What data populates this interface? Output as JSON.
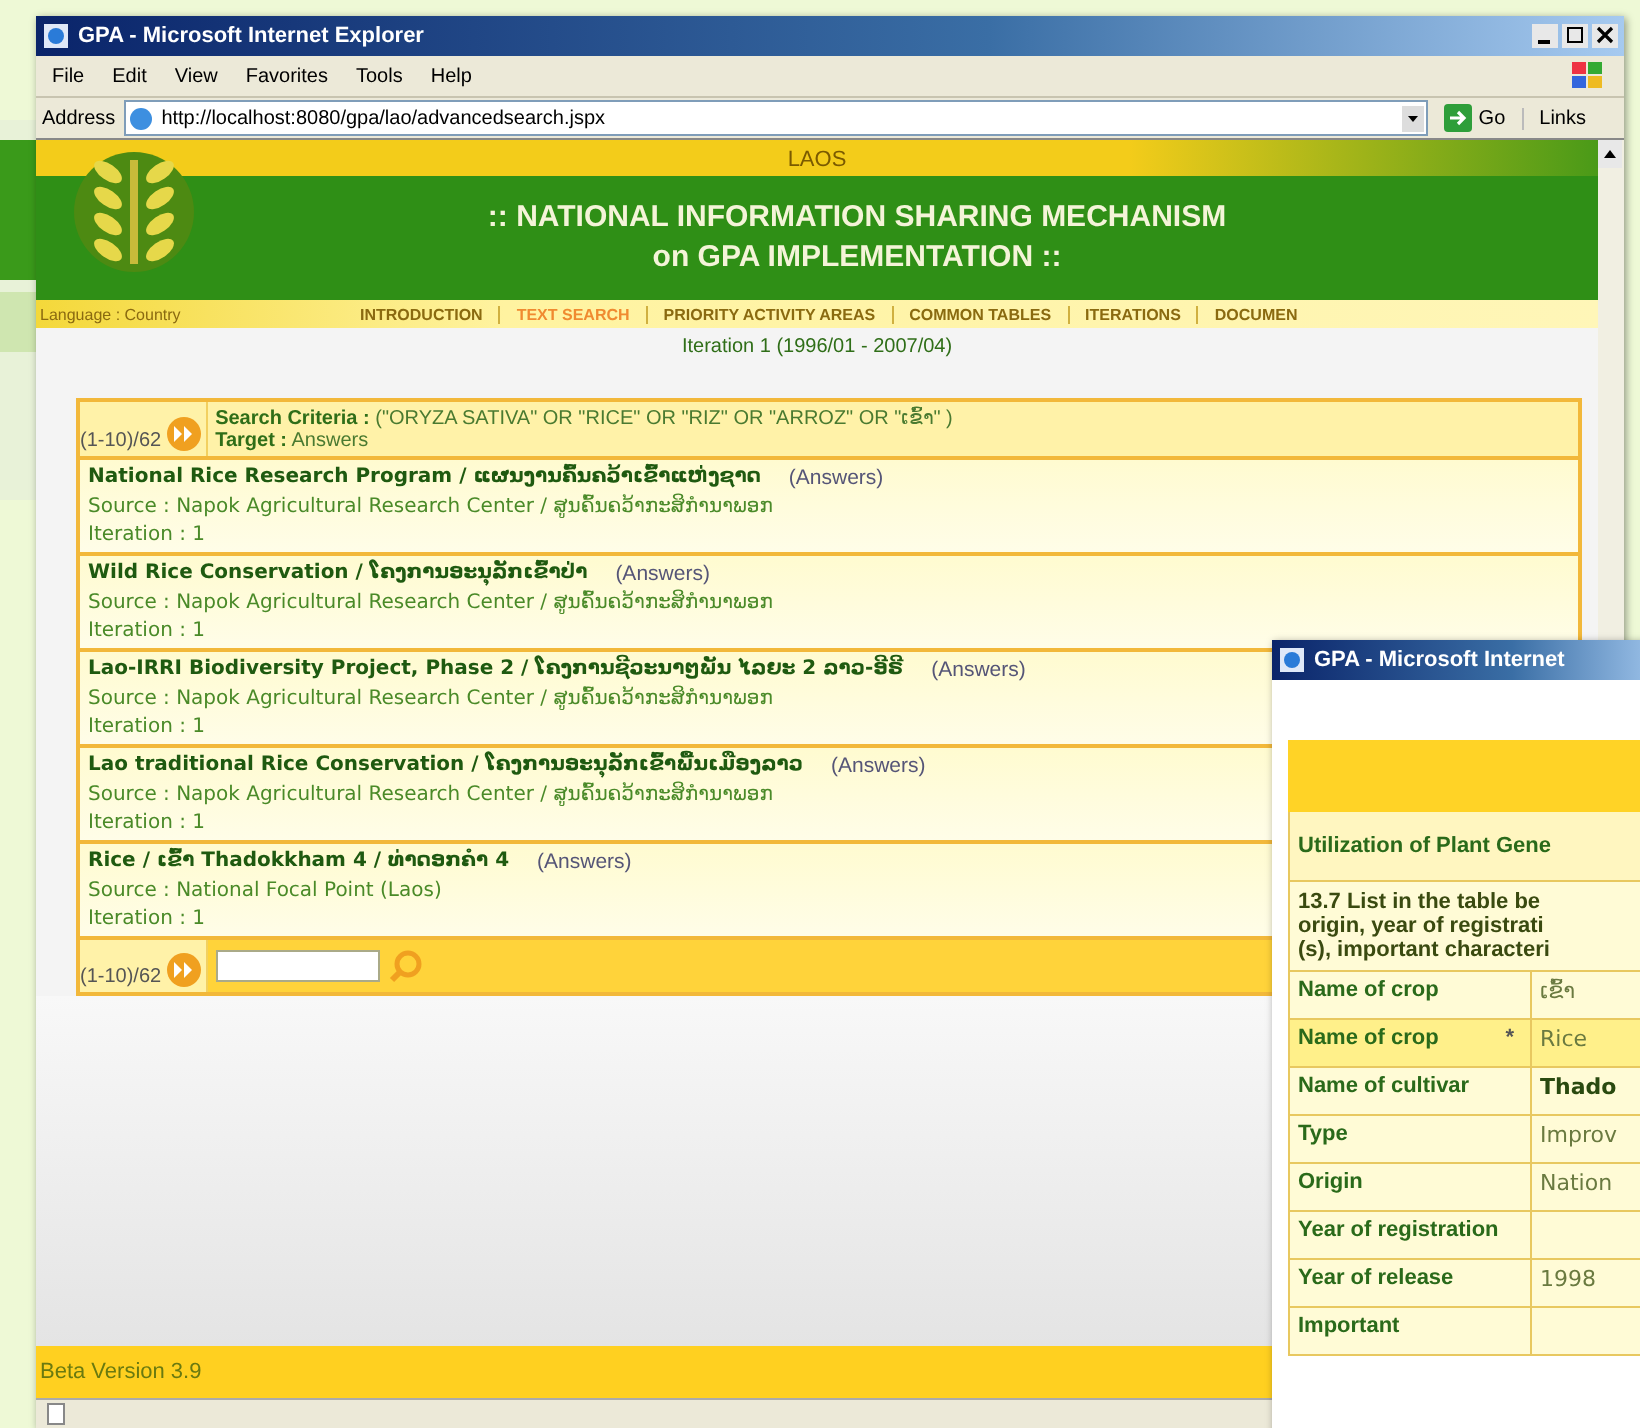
{
  "window": {
    "title": "GPA - Microsoft Internet Explorer"
  },
  "menu": [
    "File",
    "Edit",
    "View",
    "Favorites",
    "Tools",
    "Help"
  ],
  "address_bar": {
    "label": "Address",
    "value": "http://localhost:8080/gpa/lao/advancedsearch.jspx",
    "go": "Go",
    "links": "Links"
  },
  "banner": {
    "country": "LAOS",
    "title_line_1": ":: NATIONAL INFORMATION SHARING MECHANISM",
    "title_line_2": "on GPA IMPLEMENTATION ::"
  },
  "language_link": "Language : Country",
  "nav": [
    {
      "label": "INTRODUCTION",
      "selected": false
    },
    {
      "label": "TEXT SEARCH",
      "selected": true
    },
    {
      "label": "PRIORITY ACTIVITY AREAS",
      "selected": false
    },
    {
      "label": "COMMON TABLES",
      "selected": false
    },
    {
      "label": "ITERATIONS",
      "selected": false
    },
    {
      "label": "DOCUMEN",
      "selected": false
    }
  ],
  "iteration_heading": "Iteration  1 (1996/01 - 2007/04)",
  "results": {
    "range": "(1-10)/62",
    "criteria_label": "Search Criteria :",
    "criteria": "(\"ORYZA SATIVA\" OR \"RICE\" OR \"RIZ\" OR \"ARROZ\" OR \"ເຂົ້າ\" )",
    "target_label": "Target :",
    "target": "Answers",
    "items": [
      {
        "title": "National Rice Research Program / ແຜນງານຄົ້ນຄວ້າເຂົ້າແຫ່ງຊາດ",
        "type": "(Answers)",
        "source": "Source : Napok Agricultural Research Center / ສູນຄົ້ນຄວ້າກະສິກຳນາພອກ",
        "iteration": "Iteration : 1"
      },
      {
        "title": "Wild Rice Conservation / ໂຄງການອະນຸລັກເຂົ້າປ່າ",
        "type": "(Answers)",
        "source": "Source : Napok Agricultural Research Center / ສູນຄົ້ນຄວ້າກະສິກຳນາພອກ",
        "iteration": "Iteration : 1"
      },
      {
        "title": "Lao-IRRI Biodiversity Project, Phase 2 / ໂຄງການຊີວະນາໆພັນ ໄລຍະ 2 ລາວ-ອີຣີ",
        "type": "(Answers)",
        "source": "Source : Napok Agricultural Research Center / ສູນຄົ້ນຄວ້າກະສິກຳນາພອກ",
        "iteration": "Iteration : 1"
      },
      {
        "title": "Lao traditional Rice Conservation / ໂຄງການອະນຸລັກເຂົ້າພື້ນເມືອງລາວ",
        "type": "(Answers)",
        "source": "Source : Napok Agricultural Research Center / ສູນຄົ້ນຄວ້າກະສິກຳນາພອກ",
        "iteration": "Iteration : 1"
      },
      {
        "title": "Rice / ເຂົ້າ  Thadokkham 4 / ທ່າດອກຄຳ 4",
        "type": "(Answers)",
        "source": "Source : National Focal Point (Laos)",
        "iteration": "Iteration : 1"
      }
    ],
    "pager_range": "(1-10)/62"
  },
  "footer": "Beta Version 3.9",
  "popup": {
    "title": "GPA - Microsoft Internet",
    "heading": "Utilization of Plant Gene",
    "question": [
      "13.7  List in the table be",
      "origin, year of registrati",
      "(s), important characteri"
    ],
    "rows": [
      {
        "label": "Name of crop",
        "value": "ເຂົ້າ",
        "highlighted": false,
        "bold": false
      },
      {
        "label": "Name of crop",
        "marker": "*",
        "value": "Rice",
        "highlighted": true,
        "bold": false
      },
      {
        "label": "Name of cultivar",
        "value": "Thado",
        "highlighted": false,
        "bold": true
      },
      {
        "label": "Type",
        "value": "Improv",
        "highlighted": false,
        "bold": false
      },
      {
        "label": "Origin",
        "value": "Nation",
        "highlighted": false,
        "bold": false
      },
      {
        "label": "Year of registration",
        "highlighted": false
      },
      {
        "label": "Year of release",
        "value": "1998",
        "highlighted": false,
        "bold": false
      },
      {
        "label": "Important",
        "highlighted": false
      }
    ]
  }
}
